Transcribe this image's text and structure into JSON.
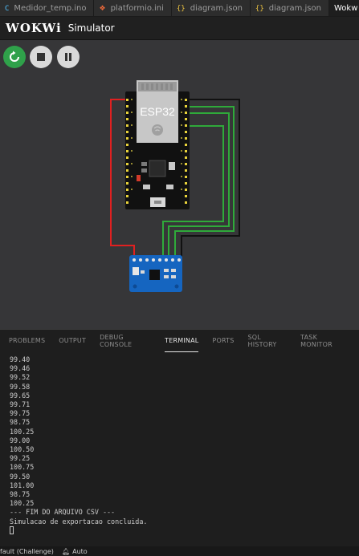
{
  "tabs": [
    {
      "icon": "C",
      "label": "Medidor_temp.ino"
    },
    {
      "icon": "❖",
      "label": "platformio.ini"
    },
    {
      "icon": "{}",
      "label": "diagram.json"
    },
    {
      "icon": "{}",
      "label": "diagram.json"
    },
    {
      "icon": "",
      "label": "Wokw"
    }
  ],
  "header": {
    "logo": "WOKWi",
    "title": "Simulator"
  },
  "board": {
    "label": "ESP32"
  },
  "wire_colors": {
    "red": "#e02020",
    "black": "#111111",
    "green": "#2faa3a",
    "board": "#111111",
    "sensor": "#1565c0"
  },
  "panel": {
    "tabs": [
      "PROBLEMS",
      "OUTPUT",
      "DEBUG CONSOLE",
      "TERMINAL",
      "PORTS",
      "SQL HISTORY",
      "TASK MONITOR"
    ],
    "active_tab": "TERMINAL",
    "terminal_lines": [
      "99.40",
      "99.46",
      "99.52",
      "99.58",
      "99.65",
      "99.71",
      "99.75",
      "98.75",
      "100.25",
      "99.00",
      "100.50",
      "99.25",
      "100.75",
      "99.50",
      "101.00",
      "98.75",
      "100.25",
      "--- FIM DO ARQUIVO CSV ---",
      "Simulacao de exportacao concluida."
    ]
  },
  "statusbar": {
    "profile": "fault (Challenge)",
    "auto": "Auto"
  }
}
